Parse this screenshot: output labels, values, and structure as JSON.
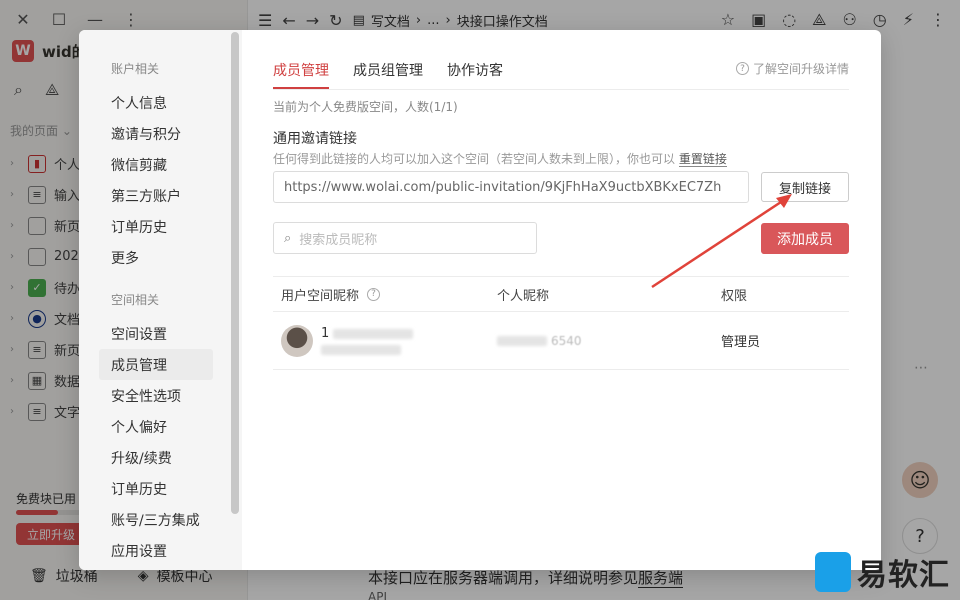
{
  "background": {
    "window_buttons": [
      "✕",
      "☐",
      "—",
      "⋮"
    ],
    "workspace": {
      "logo_letter": "W",
      "name": "wid的"
    },
    "my_pages_label": "我的页面 ⌄",
    "tree_items": [
      {
        "label": "个人",
        "icon": "bookmark-icon"
      },
      {
        "label": "输入",
        "icon": "doc-icon"
      },
      {
        "label": "新页",
        "icon": "page-icon"
      },
      {
        "label": "202",
        "icon": "page-icon"
      },
      {
        "label": "待办",
        "icon": "check-icon"
      },
      {
        "label": "文档",
        "icon": "eye-icon"
      },
      {
        "label": "新页",
        "icon": "doc-icon"
      },
      {
        "label": "数据",
        "icon": "table-icon"
      },
      {
        "label": "文字",
        "icon": "doc-icon"
      }
    ],
    "quota_label": "免费块已用",
    "quota_fraction": 0.19,
    "upgrade_label": "立即升级",
    "trash_label": "垃圾桶",
    "template_label": "模板中心",
    "breadcrumb": [
      "写文档",
      "...",
      "块接口操作文档"
    ],
    "content_text_prefix": "本接口应在服务器端调用，详细说明参见",
    "content_text_link": "服务端",
    "content_text_next": "API",
    "brand_text": "易软汇"
  },
  "settings": {
    "nav": {
      "account_section": "账户相关",
      "account_items": [
        "个人信息",
        "邀请与积分",
        "微信剪藏",
        "第三方账户",
        "订单历史",
        "更多"
      ],
      "space_section": "空间相关",
      "space_items": [
        "空间设置",
        "成员管理",
        "安全性选项",
        "个人偏好",
        "升级/续费",
        "订单历史",
        "账号/三方集成",
        "应用设置"
      ],
      "active_item": "成员管理"
    },
    "tabs": [
      "成员管理",
      "成员组管理",
      "协作访客"
    ],
    "active_tab": "成员管理",
    "upgrade_link": "了解空间升级详情",
    "plan_note": "当前为个人免费版空间，人数(1/1)",
    "invite": {
      "title": "通用邀请链接",
      "desc_prefix": "任何得到此链接的人均可以加入这个空间（若空间人数未到上限），你也可以",
      "reset_label": "重置链接",
      "url": "https://www.wolai.com/public-invitation/9KjFhHaX9uctbXBKxEC7Zh",
      "copy_label": "复制链接"
    },
    "search_placeholder": "搜索成员昵称",
    "add_member_label": "添加成员",
    "table": {
      "headers": [
        "用户空间昵称",
        "个人昵称",
        "权限"
      ],
      "rows": [
        {
          "space_nick": "1",
          "personal_nick": "6540",
          "role": "管理员"
        }
      ]
    }
  }
}
